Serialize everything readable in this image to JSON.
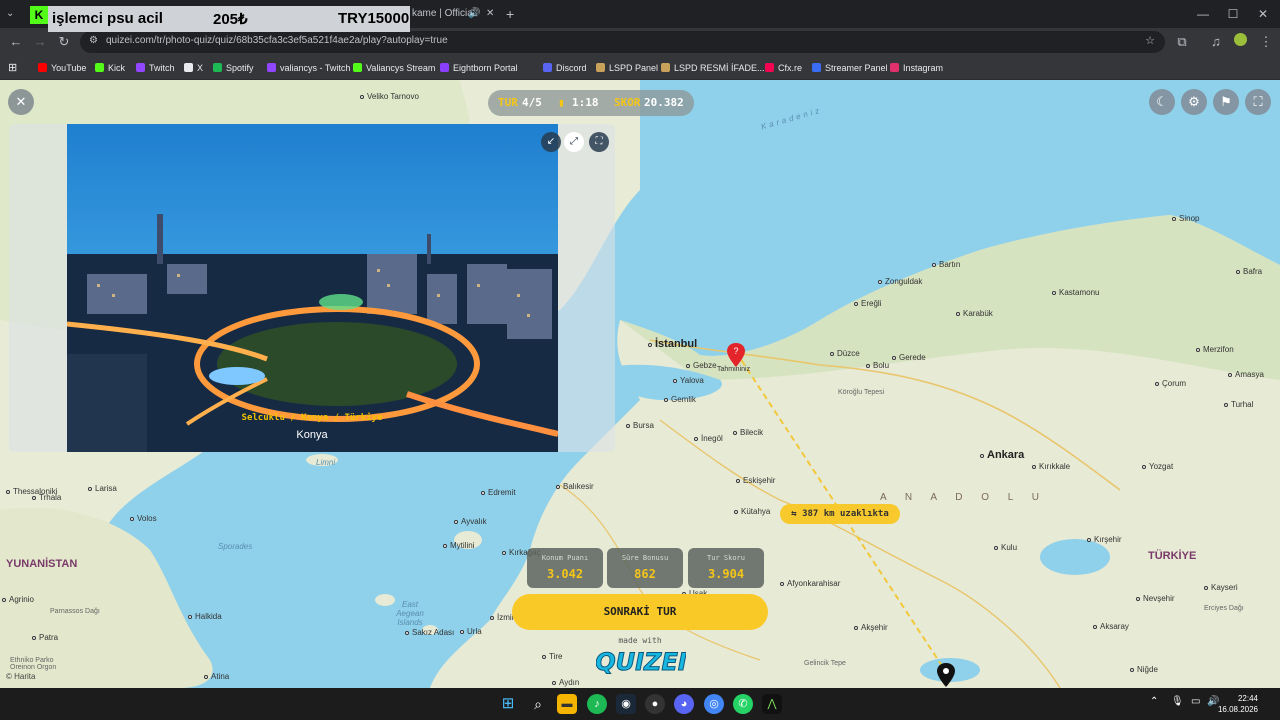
{
  "browser": {
    "overlay": {
      "text1": "işlemci psu acil",
      "text2": "205₺",
      "text3": "TRY15000",
      "badge": "K"
    },
    "tab_title": "kame | Official",
    "new_tab": "+",
    "window": {
      "minimize": "—",
      "maximize": "☐",
      "close": "✕"
    },
    "url": "quizei.com/tr/photo-quiz/quiz/68b35cfa3c3ef5a521f4ae2a/play?autoplay=true",
    "bookmarks": [
      {
        "label": "YouTube",
        "color": "#ff0000"
      },
      {
        "label": "Kick",
        "color": "#53fc18"
      },
      {
        "label": "Twitch",
        "color": "#9146ff"
      },
      {
        "label": "X",
        "color": "#e8eaed"
      },
      {
        "label": "Spotify",
        "color": "#1db954"
      },
      {
        "label": "valiancys - Twitch",
        "color": "#9146ff"
      },
      {
        "label": "Valiancys Stream",
        "color": "#53fc18"
      },
      {
        "label": "Eightborn Portal",
        "color": "#8a3ffc"
      },
      {
        "label": "Discord",
        "color": "#5865f2"
      },
      {
        "label": "LSPD Panel",
        "color": "#c8a25a"
      },
      {
        "label": "LSPD  RESMİ İFADE...",
        "color": "#c8a25a"
      },
      {
        "label": "Cfx.re",
        "color": "#f40552"
      },
      {
        "label": "Streamer Panel",
        "color": "#3a6cf4"
      },
      {
        "label": "Instagram",
        "color": "#e1306c"
      }
    ]
  },
  "hud": {
    "round_label": "TUR",
    "round_value": "4/5",
    "time": "1:18",
    "score_label": "SKOR",
    "score_value": "20.382"
  },
  "photo": {
    "path": "Selcuklu / Konya / Türkiye",
    "name": "Konya"
  },
  "distance": "387 km uzaklıkta",
  "guess_label": "Tahmininiz",
  "scores": [
    {
      "label": "Konum Puanı",
      "value": "3.042"
    },
    {
      "label": "Süre Bonusu",
      "value": "862"
    },
    {
      "label": "Tur Skoru",
      "value": "3.904"
    }
  ],
  "next_button": "SONRAKİ TUR",
  "made_with": "made with",
  "logo_text": "QUIZEI",
  "map_labels": {
    "sea_black": "Karadeniz",
    "region": "A N A D O L U",
    "country_tr": "TÜRKİYE",
    "country_gr": "YUNANİSTAN",
    "attribution": "© Harita",
    "cities": [
      {
        "name": "İstanbul",
        "big": true
      },
      {
        "name": "Ankara",
        "big": true
      },
      {
        "name": "Veliko Tarnovo"
      },
      {
        "name": "Sinop"
      },
      {
        "name": "Bartın"
      },
      {
        "name": "Bafra"
      },
      {
        "name": "Zonguldak"
      },
      {
        "name": "Kastamonu"
      },
      {
        "name": "Ereğli"
      },
      {
        "name": "Karabük"
      },
      {
        "name": "Düzce"
      },
      {
        "name": "Gerede"
      },
      {
        "name": "Bolu"
      },
      {
        "name": "Merzifon"
      },
      {
        "name": "Çorum"
      },
      {
        "name": "Amasya"
      },
      {
        "name": "Turhal"
      },
      {
        "name": "Gebze"
      },
      {
        "name": "Yalova"
      },
      {
        "name": "Gemlik"
      },
      {
        "name": "Bursa"
      },
      {
        "name": "İnegöl"
      },
      {
        "name": "Bilecik"
      },
      {
        "name": "Eskişehir"
      },
      {
        "name": "Kırıkkale"
      },
      {
        "name": "Yozgat"
      },
      {
        "name": "Balıkesir"
      },
      {
        "name": "Edremit"
      },
      {
        "name": "Ayvalık"
      },
      {
        "name": "Kütahya"
      },
      {
        "name": "Kırşehir"
      },
      {
        "name": "Afyonkarahisar"
      },
      {
        "name": "Kayseri"
      },
      {
        "name": "Nevşehir"
      },
      {
        "name": "Aksaray"
      },
      {
        "name": "Akşehir"
      },
      {
        "name": "Niğde"
      },
      {
        "name": "Larisa"
      },
      {
        "name": "Volos"
      },
      {
        "name": "Mytilini"
      },
      {
        "name": "Halkida"
      },
      {
        "name": "Atina"
      },
      {
        "name": "Patra"
      },
      {
        "name": "İzmir"
      },
      {
        "name": "Sakız Adası"
      },
      {
        "name": "Urla"
      },
      {
        "name": "Tire"
      },
      {
        "name": "Aydın"
      },
      {
        "name": "Kırkağaç"
      },
      {
        "name": "Uşak"
      },
      {
        "name": "Kulu"
      },
      {
        "name": "Agrinio"
      },
      {
        "name": "Thessaloniki"
      },
      {
        "name": "Trhala"
      }
    ],
    "landmarks": [
      {
        "name": "Köroğlu Tepesi"
      },
      {
        "name": "Gelincik Tepe"
      },
      {
        "name": "Parnassos Dağı"
      },
      {
        "name": "Erciyes Dağı"
      },
      {
        "name": "Ethniko Parko Oreinon Orgon"
      }
    ],
    "seas": [
      {
        "name": "Limni"
      },
      {
        "name": "Sporades"
      },
      {
        "name": "East Aegean Islands"
      }
    ]
  },
  "taskbar": {
    "time": "22:44",
    "date": "16.08.2026"
  }
}
